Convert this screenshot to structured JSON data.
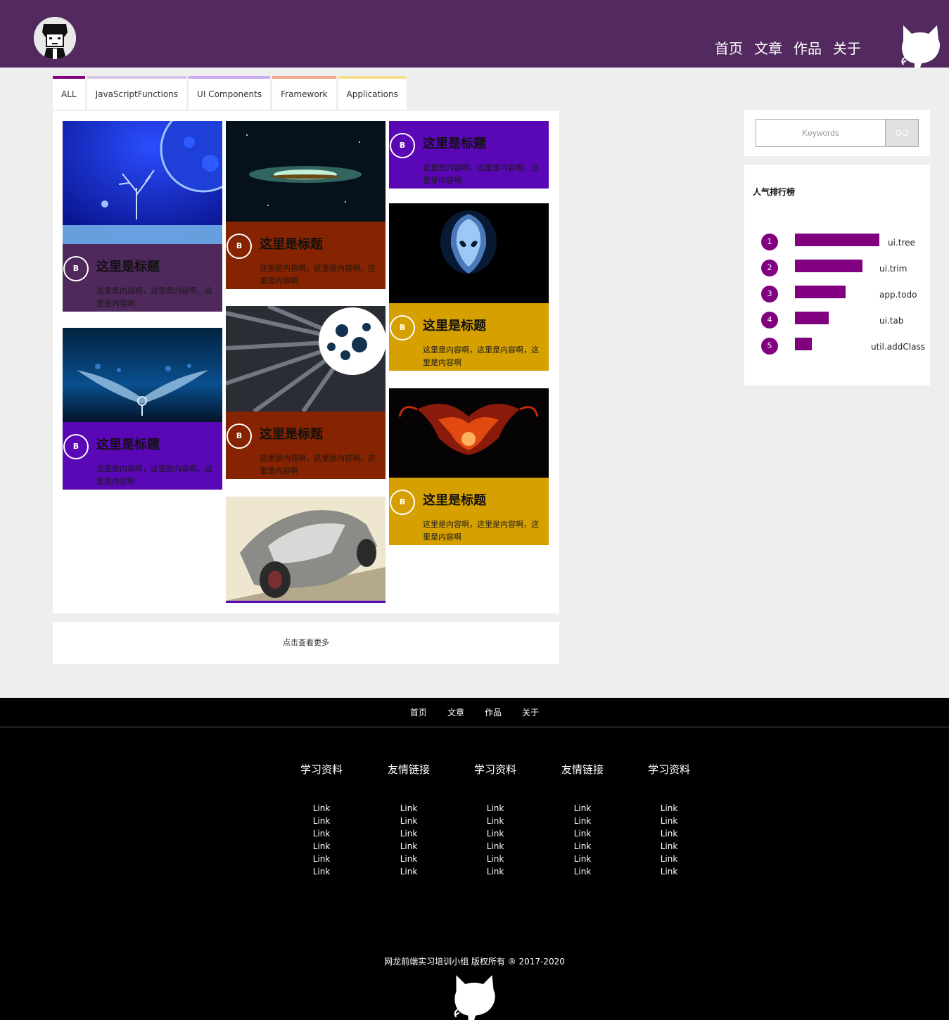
{
  "header": {
    "nav": [
      "首页",
      "文章",
      "作品",
      "关于"
    ]
  },
  "tabs": [
    {
      "label": "ALL",
      "color": "#800080"
    },
    {
      "label": "JavaScriptFunctions",
      "color": "#d6c4e4"
    },
    {
      "label": "UI Components",
      "color": "#c9a9f0"
    },
    {
      "label": "Framework",
      "color": "#f2a98c"
    },
    {
      "label": "Applications",
      "color": "#f5e08e"
    }
  ],
  "cards": [
    {
      "badge": "B",
      "title": "这里是标题",
      "text": "这里是内容啊，这里是内容啊，这里是内容啊",
      "color": "#4f285c",
      "image": "moon-tree"
    },
    {
      "badge": "B",
      "title": "这里是标题",
      "text": "这里是内容啊，这里是内容啊，这里是内容啊",
      "color": "#5a07b5",
      "image": "blue-wings"
    },
    {
      "badge": "B",
      "title": "这里是标题",
      "text": "这里是内容啊，这里是内容啊，这里是内容啊",
      "color": "#862300",
      "image": "galaxy"
    },
    {
      "badge": "B",
      "title": "这里是标题",
      "text": "这里是内容啊，这里是内容啊，这里是内容啊",
      "color": "#862300",
      "image": "planet-rays"
    },
    {
      "badge": "",
      "title": "",
      "text": "",
      "color": "#5a07b5",
      "image": "concept-car"
    },
    {
      "badge": "B",
      "title": "这里是标题",
      "text": "这里是内容啊，这里是内容啊，这里是内容啊",
      "color": "#5a07b5",
      "image": ""
    },
    {
      "badge": "B",
      "title": "这里是标题",
      "text": "这里是内容啊，这里是内容啊，这里是内容啊",
      "color": "#d6a000",
      "image": "alien-logo"
    },
    {
      "badge": "B",
      "title": "这里是标题",
      "text": "这里是内容啊，这里是内容啊，这里是内容啊",
      "color": "#d6a000",
      "image": "red-abstract"
    }
  ],
  "more_label": "点击查看更多",
  "search": {
    "placeholder": "Keywords",
    "button": "GO"
  },
  "ranking": {
    "title": "人气排行榜",
    "items": [
      {
        "rank": "1",
        "label": "ui.tree",
        "value": 5
      },
      {
        "rank": "2",
        "label": "ui.trim",
        "value": 4
      },
      {
        "rank": "3",
        "label": "app.todo",
        "value": 3
      },
      {
        "rank": "4",
        "label": "ui.tab",
        "value": 2
      },
      {
        "rank": "5",
        "label": "util.addClass",
        "value": 1
      }
    ]
  },
  "footer": {
    "nav": [
      "首页",
      "文章",
      "作品",
      "关于"
    ],
    "columns": [
      {
        "title": "学习资料",
        "links": [
          "Link",
          "Link",
          "Link",
          "Link",
          "Link",
          "Link"
        ]
      },
      {
        "title": "友情链接",
        "links": [
          "Link",
          "Link",
          "Link",
          "Link",
          "Link",
          "Link"
        ]
      },
      {
        "title": "学习资料",
        "links": [
          "Link",
          "Link",
          "Link",
          "Link",
          "Link",
          "Link"
        ]
      },
      {
        "title": "友情链接",
        "links": [
          "Link",
          "Link",
          "Link",
          "Link",
          "Link",
          "Link"
        ]
      },
      {
        "title": "学习资料",
        "links": [
          "Link",
          "Link",
          "Link",
          "Link",
          "Link",
          "Link"
        ]
      }
    ],
    "copyright": "网龙前端实习培训小组 版权所有 ® 2017-2020"
  }
}
